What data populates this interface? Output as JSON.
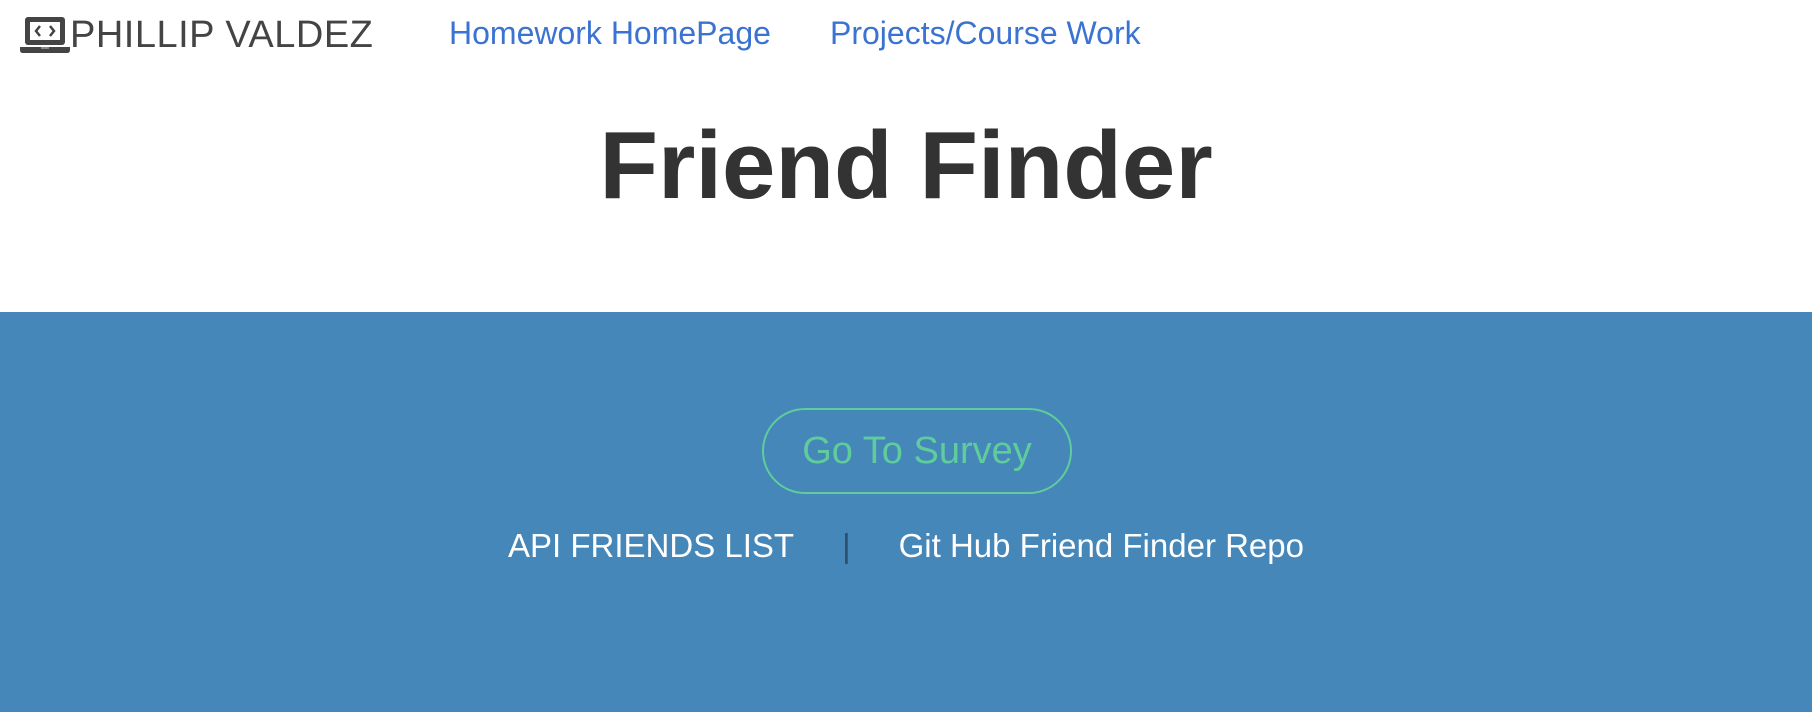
{
  "navbar": {
    "brand_icon": "laptop-code-icon",
    "brand_name": "PHILLIP VALDEZ",
    "links": [
      {
        "label": "Homework HomePage"
      },
      {
        "label": "Projects/Course Work"
      }
    ]
  },
  "hero": {
    "title": "Friend Finder"
  },
  "footer": {
    "survey_button": "Go To Survey",
    "api_link": "API FRIENDS LIST",
    "separator": "|",
    "repo_link": "Git Hub Friend Finder Repo"
  },
  "colors": {
    "nav_link": "#3a73d1",
    "band_background": "#4587b9",
    "survey_accent": "#5fcc9c",
    "title_text": "#333333"
  }
}
